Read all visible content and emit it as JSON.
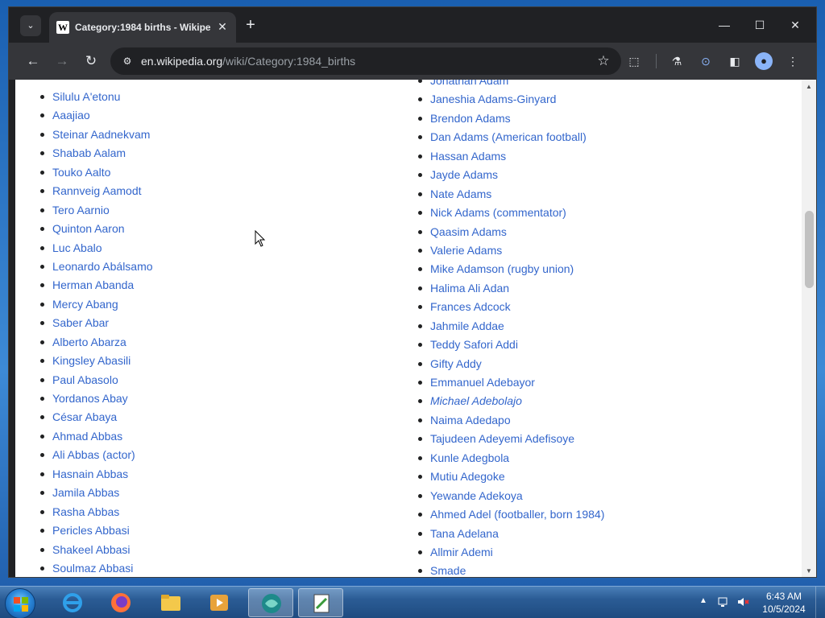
{
  "browser": {
    "tab": {
      "title": "Category:1984 births - Wikipe",
      "favicon": "W",
      "close_icon": "✕"
    },
    "new_tab_icon": "+",
    "window_controls": {
      "minimize": "—",
      "maximize": "☐",
      "close": "✕"
    },
    "toolbar": {
      "back": "←",
      "forward": "→",
      "reload": "↻",
      "url_host": "en.wikipedia.org",
      "url_path": "/wiki/Category:1984_births",
      "bookmark_icon": "☆"
    }
  },
  "page": {
    "left_column": [
      "Silulu A'etonu",
      "Aaajiao",
      "Steinar Aadnekvam",
      "Shabab Aalam",
      "Touko Aalto",
      "Rannveig Aamodt",
      "Tero Aarnio",
      "Quinton Aaron",
      "Luc Abalo",
      "Leonardo Abálsamo",
      "Herman Abanda",
      "Mercy Abang",
      "Saber Abar",
      "Alberto Abarza",
      "Kingsley Abasili",
      "Paul Abasolo",
      "Yordanos Abay",
      "César Abaya",
      "Ahmad Abbas",
      "Ali Abbas (actor)",
      "Hasnain Abbas",
      "Jamila Abbas",
      "Rasha Abbas",
      "Pericles Abbasi",
      "Shakeel Abbasi",
      "Soulmaz Abbasi"
    ],
    "right_column": [
      "Jonathan Adam",
      "Janeshia Adams-Ginyard",
      "Brendon Adams",
      "Dan Adams (American football)",
      "Hassan Adams",
      "Jayde Adams",
      "Nate Adams",
      "Nick Adams (commentator)",
      "Qaasim Adams",
      "Valerie Adams",
      "Mike Adamson (rugby union)",
      "Halima Ali Adan",
      "Frances Adcock",
      "Jahmile Addae",
      "Teddy Safori Addi",
      "Gifty Addy",
      "Emmanuel Adebayor",
      "Michael Adebolajo",
      "Naima Adedapo",
      "Tajudeen Adeyemi Adefisoye",
      "Kunle Adegbola",
      "Mutiu Adegoke",
      "Yewande Adekoya",
      "Ahmed Adel (footballer, born 1984)",
      "Tana Adelana",
      "Allmir Ademi",
      "Smade"
    ]
  },
  "taskbar": {
    "time": "6:43 AM",
    "date": "10/5/2024"
  },
  "colors": {
    "link": "#3366cc",
    "chrome_dark": "#202124",
    "chrome_toolbar": "#35363a"
  }
}
